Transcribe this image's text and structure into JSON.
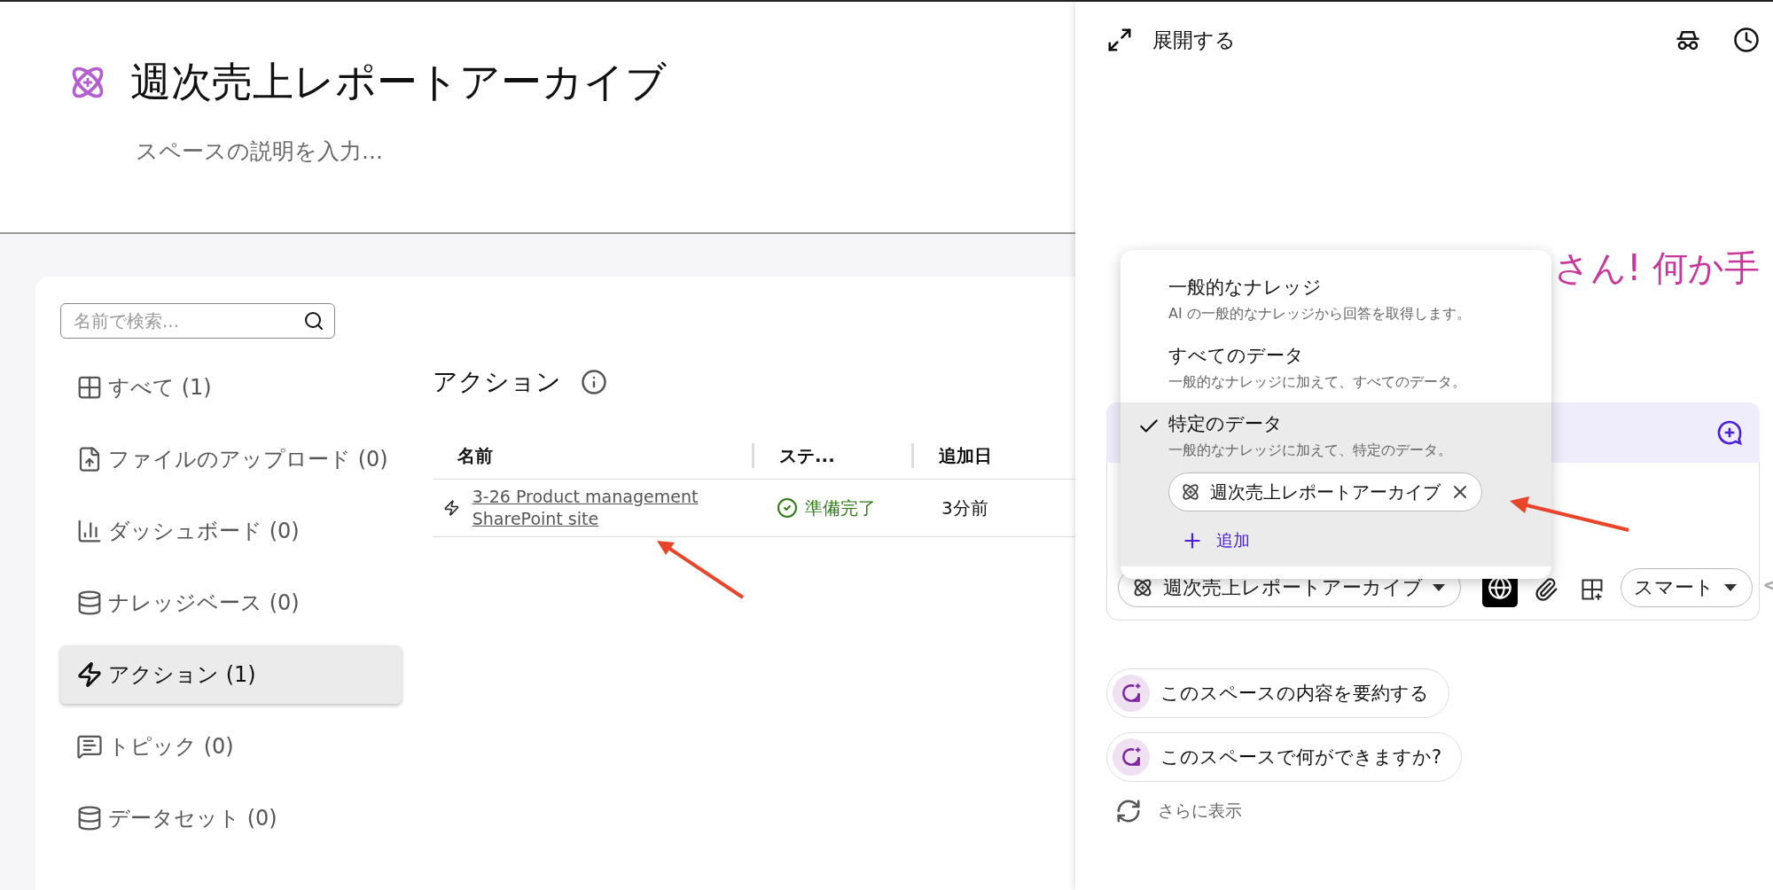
{
  "header": {
    "title": "週次売上レポートアーカイブ",
    "description": "スペースの説明を入力..."
  },
  "search": {
    "placeholder": "名前で検索..."
  },
  "sidebar": {
    "items": [
      {
        "label": "すべて (1)",
        "selected": false
      },
      {
        "label": "ファイルのアップロード (0)",
        "selected": false
      },
      {
        "label": "ダッシュボード (0)",
        "selected": false
      },
      {
        "label": "ナレッジベース (0)",
        "selected": false
      },
      {
        "label": "アクション (1)",
        "selected": true
      },
      {
        "label": "トピック (0)",
        "selected": false
      },
      {
        "label": "データセット (0)",
        "selected": false
      }
    ]
  },
  "section": {
    "title": "アクション"
  },
  "table": {
    "columns": [
      "名前",
      "ステ...",
      "追加日"
    ],
    "rows": [
      {
        "name": "3-26 Product management SharePoint site",
        "status": "準備完了",
        "added": "3分前"
      }
    ]
  },
  "panel": {
    "expand_label": "展開する",
    "greeting": "さん! 何か手",
    "menu": {
      "items": [
        {
          "title": "一般的なナレッジ",
          "description": "AI の一般的なナレッジから回答を取得します。",
          "selected": false
        },
        {
          "title": "すべてのデータ",
          "description": "一般的なナレッジに加えて、すべてのデータ。",
          "selected": false
        },
        {
          "title": "特定のデータ",
          "description": "一般的なナレッジに加えて、特定のデータ。",
          "selected": true
        }
      ],
      "chip": "週次売上レポートアーカイブ",
      "add_label": "追加"
    },
    "composer": {
      "space_chip": "週次売上レポートアーカイブ",
      "web_search_on": true,
      "mode": "スマート"
    },
    "suggestions": [
      "このスペースの内容を要約する",
      "このスペースで何ができますか?"
    ],
    "more_label": "さらに表示"
  }
}
